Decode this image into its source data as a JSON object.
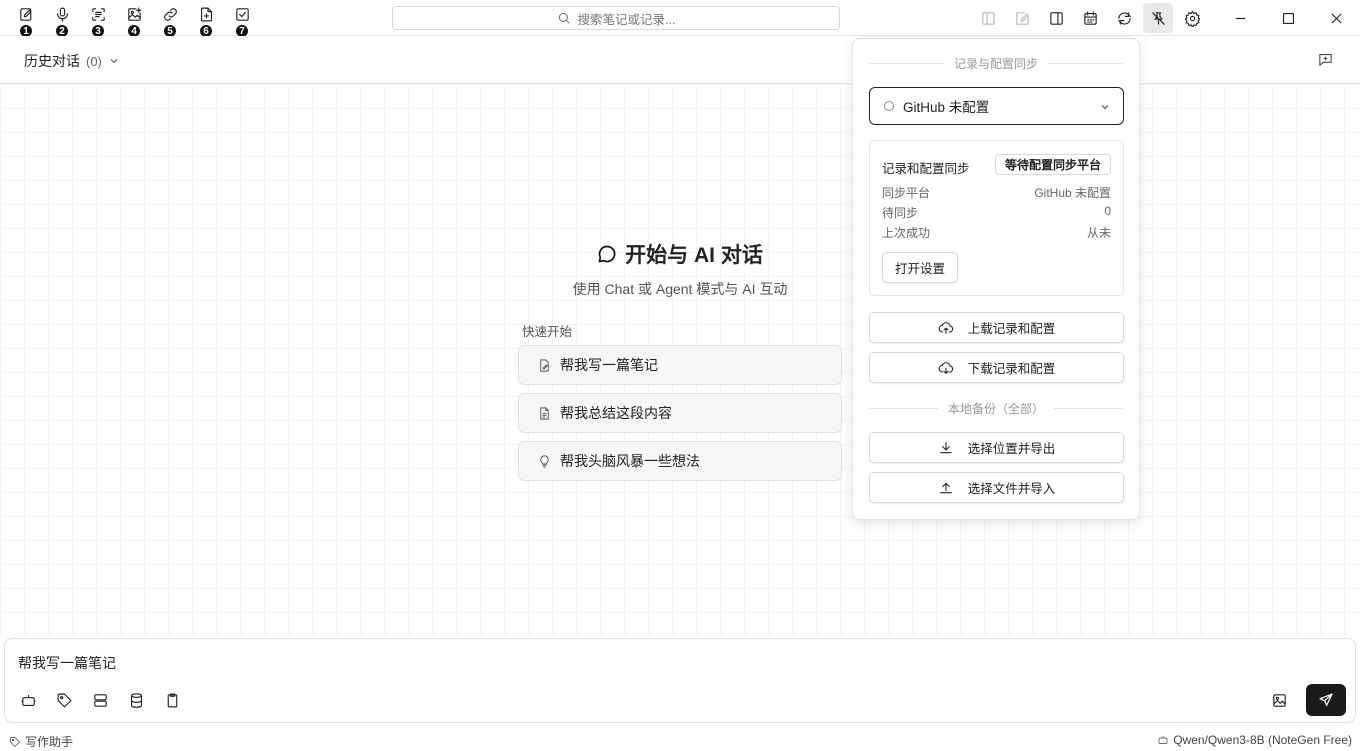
{
  "toolbar": {
    "tools": [
      {
        "icon": "note-edit-icon",
        "badge": "1"
      },
      {
        "icon": "microphone-icon",
        "badge": "2"
      },
      {
        "icon": "text-scan-icon",
        "badge": "3"
      },
      {
        "icon": "image-plus-icon",
        "badge": "4"
      },
      {
        "icon": "link-icon",
        "badge": "5"
      },
      {
        "icon": "file-plus-icon",
        "badge": "6"
      },
      {
        "icon": "checkbox-icon",
        "badge": "7"
      }
    ],
    "search_placeholder": "搜索笔记或记录..."
  },
  "subheader": {
    "history_label": "历史对话",
    "history_count": "(0)"
  },
  "hero": {
    "title": "开始与 AI 对话",
    "subtitle": "使用 Chat 或 Agent 模式与 AI 互动"
  },
  "quick_start": {
    "label": "快速开始",
    "items": [
      "帮我写一篇笔记",
      "帮我总结这段内容",
      "帮我头脑风暴一些想法"
    ]
  },
  "input": {
    "value": "帮我写一篇笔记"
  },
  "statusbar": {
    "left": "写作助手",
    "right": "Qwen/Qwen3-8B (NoteGen Free)"
  },
  "sync_panel": {
    "header": "记录与配置同步",
    "platform_select": "GitHub 未配置",
    "card_title": "记录和配置同步",
    "card_badge": "等待配置同步平台",
    "rows": [
      {
        "key": "同步平台",
        "value": "GitHub 未配置"
      },
      {
        "key": "待同步",
        "value": "0"
      },
      {
        "key": "上次成功",
        "value": "从未"
      }
    ],
    "open_settings": "打开设置",
    "upload": "上载记录和配置",
    "download": "下载记录和配置",
    "backup_header": "本地备份（全部）",
    "export": "选择位置并导出",
    "import": "选择文件并导入"
  }
}
